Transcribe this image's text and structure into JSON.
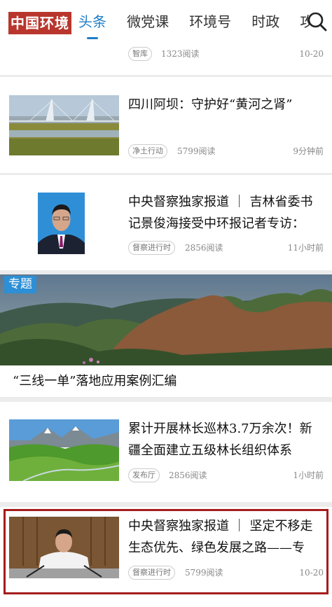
{
  "header": {
    "logo": "中国环境",
    "tabs": [
      {
        "label": "头条",
        "active": true
      },
      {
        "label": "微党课",
        "active": false
      },
      {
        "label": "环境号",
        "active": false
      },
      {
        "label": "时政",
        "active": false
      },
      {
        "label": "攻",
        "active": false
      }
    ]
  },
  "feed": [
    {
      "tag": "智库",
      "reads": "1323阅读",
      "time": "10-20"
    },
    {
      "title": "四川阿坝：守护好“黄河之肾”",
      "tag": "净土行动",
      "reads": "5799阅读",
      "time": "9分钟前",
      "thumb": "wetland-bridge-image"
    },
    {
      "title": "中央督察独家报道 ｜ 吉林省委书记景俊海接受中环报记者专访：",
      "tag": "督察进行时",
      "reads": "2856阅读",
      "time": "11小时前",
      "thumb": "portrait-image"
    },
    {
      "special_label": "专题",
      "caption": "“三线一单”落地应用案例汇编",
      "thumb": "mountain-panorama-image"
    },
    {
      "title": "累计开展林长巡林3.7万余次！新疆全面建立五级林长组织体系",
      "tag": "发布厅",
      "reads": "2856阅读",
      "time": "1小时前",
      "thumb": "grassland-valley-image"
    },
    {
      "title": "中央督察独家报道 ｜ 坚定不移走生态优先、绿色发展之路——专",
      "tag": "督察进行时",
      "reads": "5799阅读",
      "time": "10-20",
      "thumb": "speaker-image"
    }
  ],
  "colors": {
    "accent": "#1e7ec8",
    "brand": "#b8362d",
    "highlight": "#a51c1c",
    "special": "#2d8fd5"
  }
}
